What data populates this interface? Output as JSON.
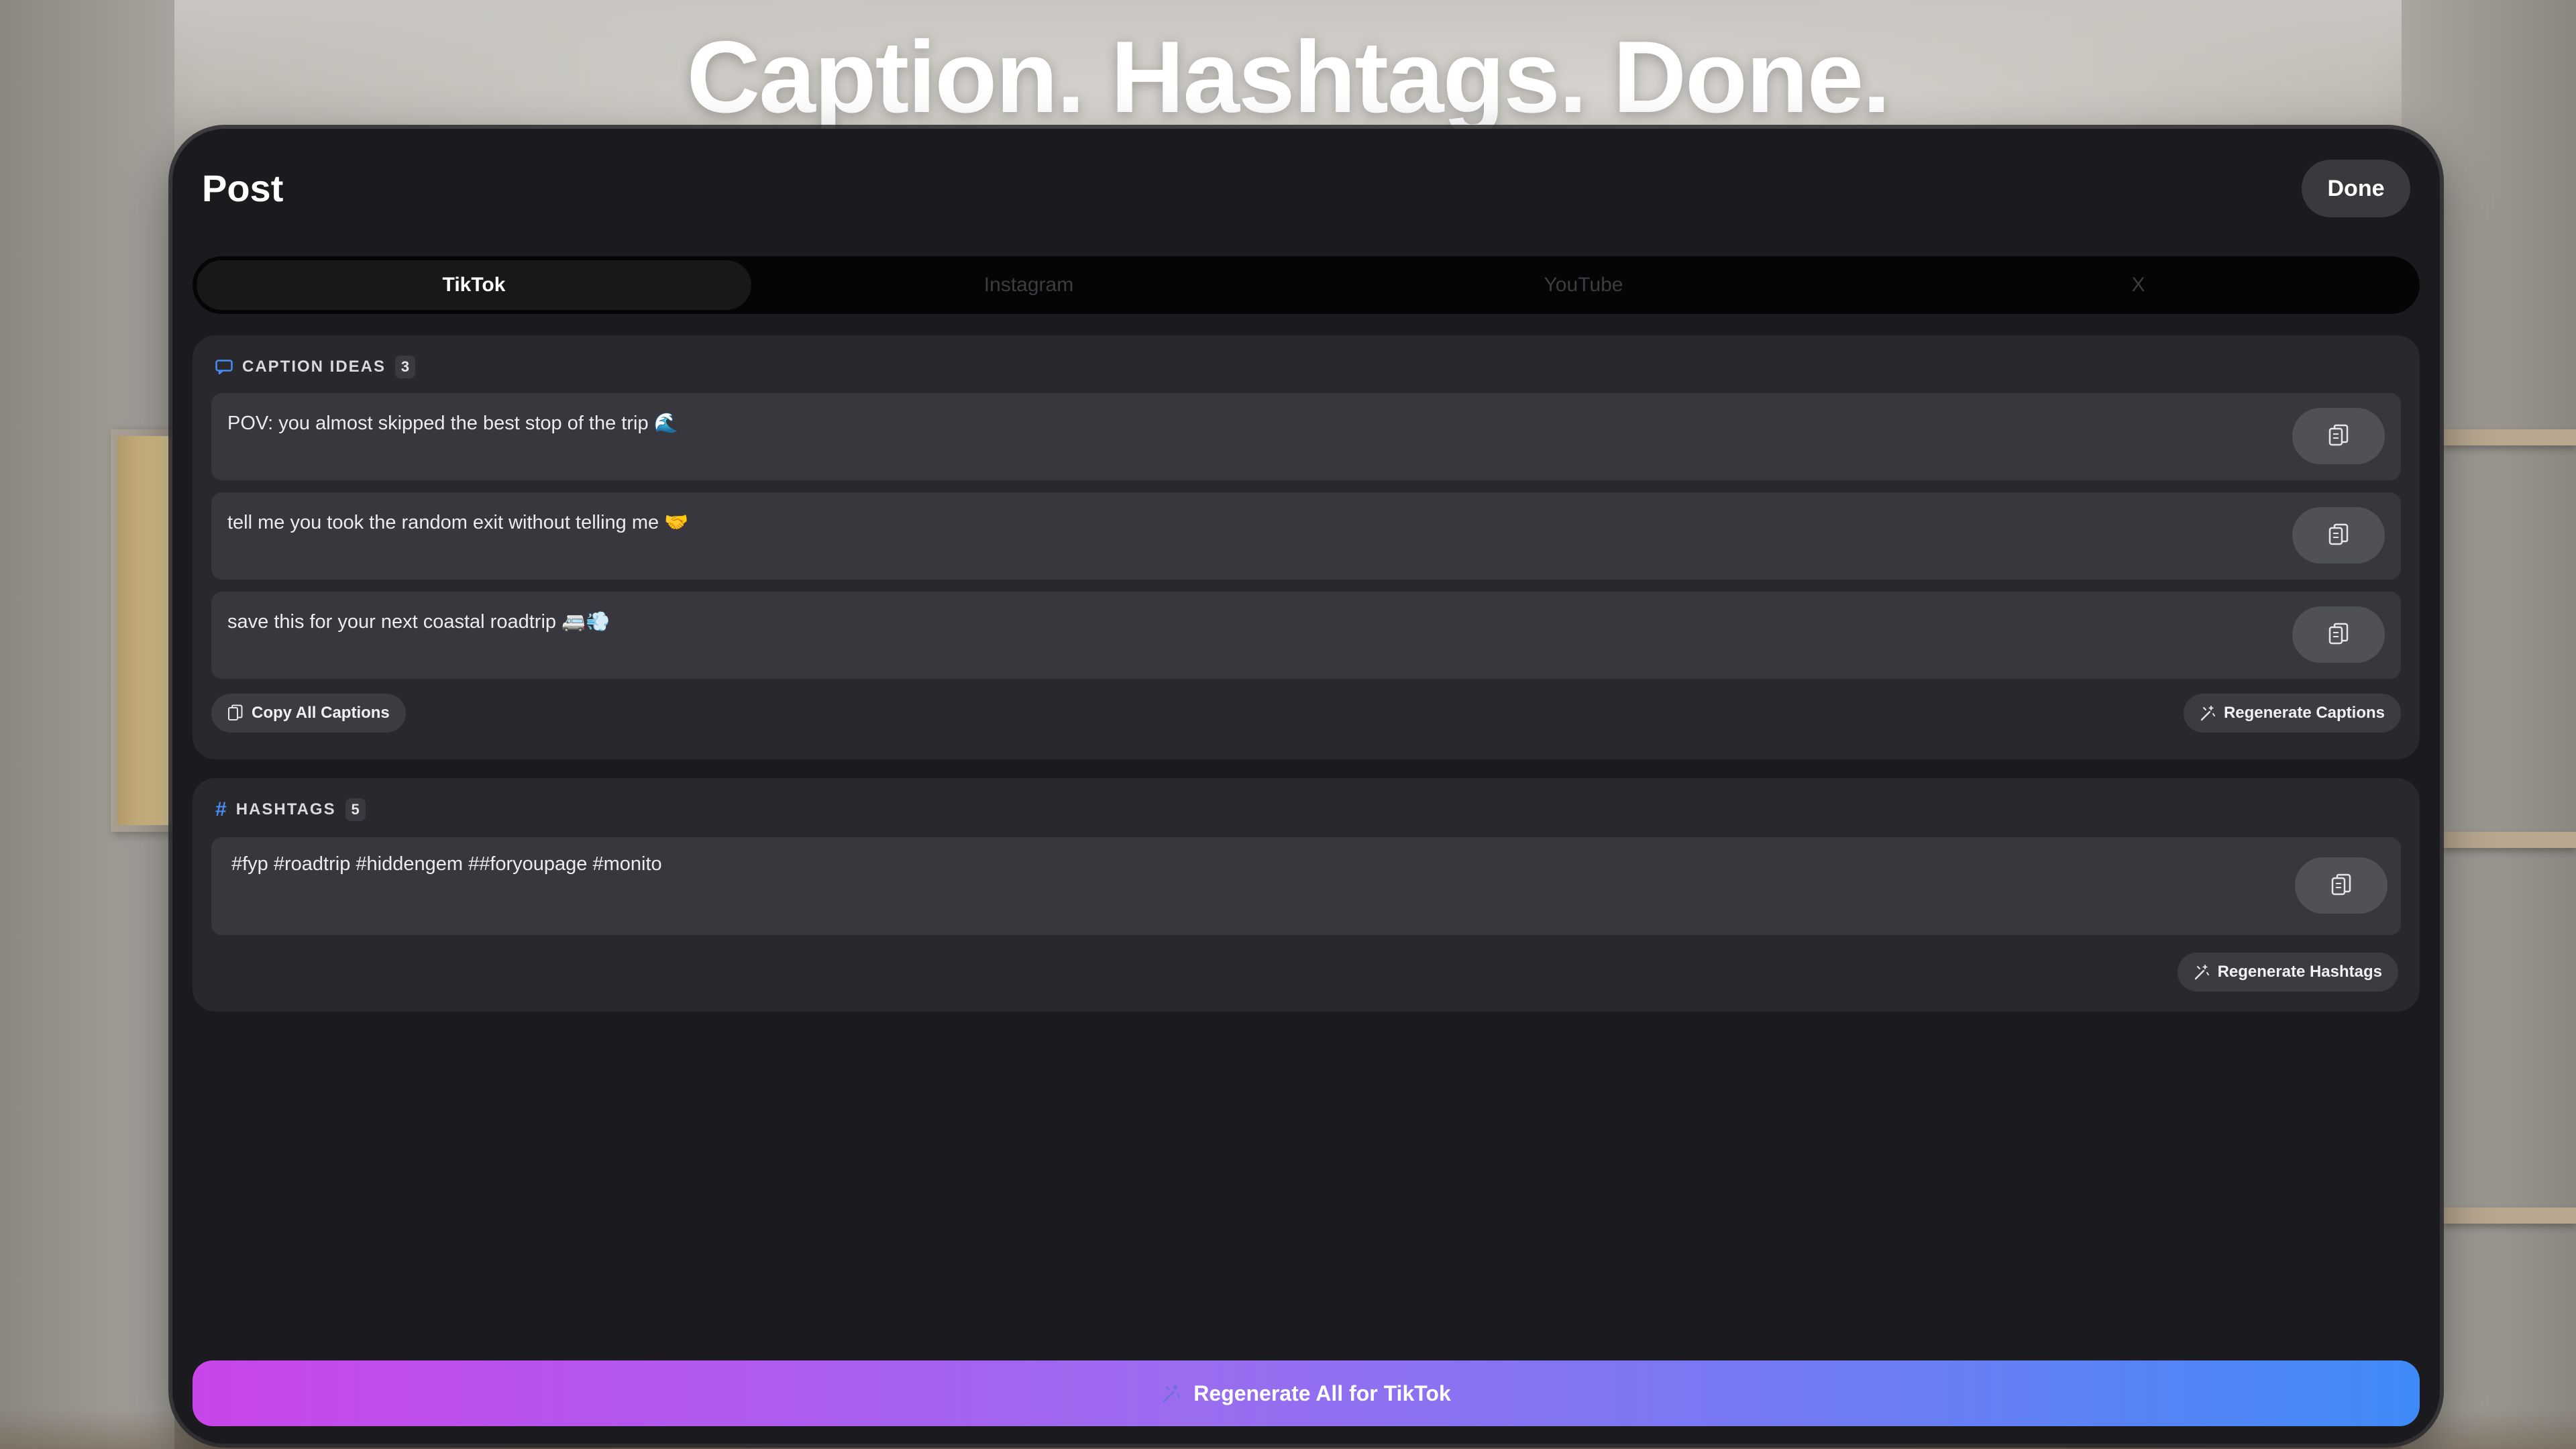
{
  "headline": "Caption. Hashtags. Done.",
  "panel": {
    "title": "Post",
    "done_label": "Done"
  },
  "tabs": [
    {
      "label": "TikTok",
      "active": true
    },
    {
      "label": "Instagram",
      "active": false
    },
    {
      "label": "YouTube",
      "active": false
    },
    {
      "label": "X",
      "active": false
    }
  ],
  "captions": {
    "heading": "CAPTION IDEAS",
    "count": "3",
    "icon": "speech-bubble-icon",
    "items": [
      "POV: you almost skipped the best stop of the trip 🌊",
      "tell me you took the random exit without telling me 🤝",
      "save this for your next coastal roadtrip 🚐💨"
    ],
    "copy_all_label": "Copy All Captions",
    "regenerate_label": "Regenerate Captions"
  },
  "hashtags": {
    "heading": "HASHTAGS",
    "count": "5",
    "icon": "hash-icon",
    "text": "#fyp #roadtrip #hiddengem ##foryoupage #monito",
    "regenerate_label": "Regenerate Hashtags"
  },
  "footer": {
    "regenerate_all_label": "Regenerate All for TikTok"
  },
  "colors": {
    "accent_blue": "#4a8af5",
    "gradient_start": "#c845ea",
    "gradient_end": "#3f8af7",
    "panel_bg": "#1b1b1f",
    "card_bg": "#28282d"
  }
}
